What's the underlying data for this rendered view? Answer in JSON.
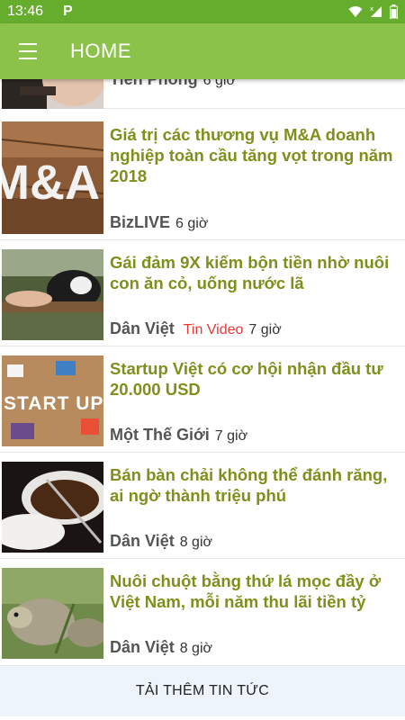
{
  "status_bar": {
    "time": "13:46",
    "notification_icon": "parking-p-icon",
    "wifi_icon": "wifi-icon",
    "signal_icon": "signal-icon",
    "battery_icon": "battery-icon"
  },
  "app_bar": {
    "title": "HOME",
    "menu_icon": "hamburger-menu-icon",
    "color": "#8bc34a"
  },
  "feed": {
    "items": [
      {
        "title": "",
        "source": "Tiền Phong",
        "tag": "",
        "time": "6 giờ"
      },
      {
        "title": "Giá trị các thương vụ M&A doanh nghiệp toàn cầu tăng vọt trong năm 2018",
        "source": "BizLIVE",
        "tag": "",
        "time": "6 giờ"
      },
      {
        "title": "Gái đảm 9X kiếm bộn tiền nhờ nuôi con ăn cỏ, uống nước lã",
        "source": "Dân Việt",
        "tag": "Tin Video",
        "time": "7 giờ"
      },
      {
        "title": "Startup Việt có cơ hội nhận đầu tư 20.000 USD",
        "source": "Một Thế Giới",
        "tag": "",
        "time": "7 giờ"
      },
      {
        "title": "Bán bàn chải không thể đánh răng, ai ngờ thành triệu phú",
        "source": "Dân Việt",
        "tag": "",
        "time": "8 giờ"
      },
      {
        "title": "Nuôi chuột bằng thứ lá mọc đầy ở Việt Nam, mỗi năm thu lãi tiền tỷ",
        "source": "Dân Việt",
        "tag": "",
        "time": "8 giờ"
      }
    ],
    "thumb_text": {
      "ma": "M&A",
      "startup": "START UP"
    }
  },
  "load_more": {
    "label": "TẢI THÊM TIN TỨC"
  },
  "colors": {
    "status_bar": "#66ad2e",
    "title_text": "#7f8f1b",
    "video_tag": "#e53935",
    "load_more_bg": "#eef4fb"
  }
}
